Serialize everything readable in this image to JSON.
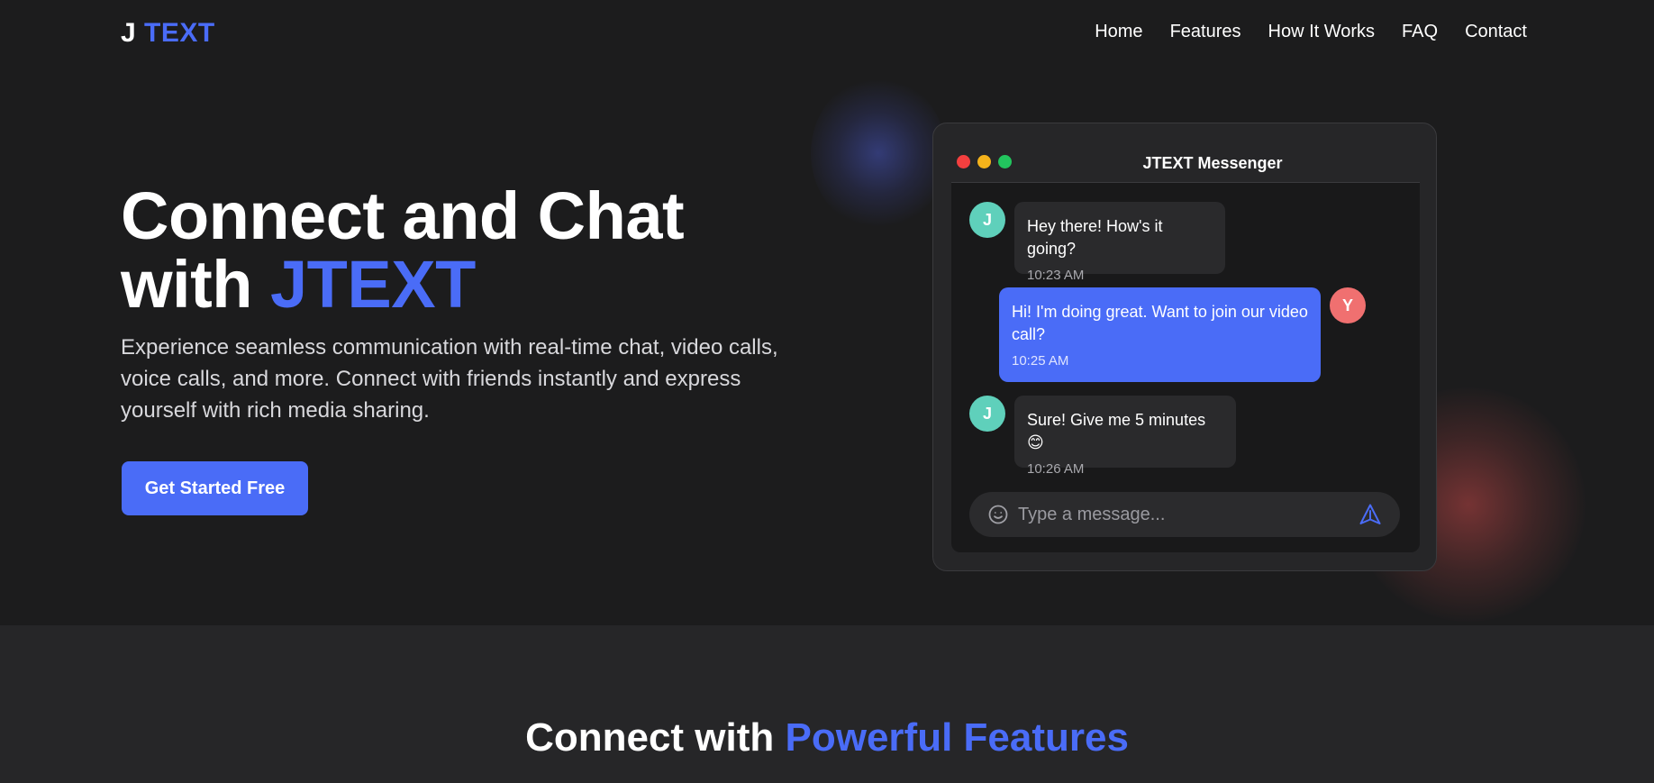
{
  "brand": {
    "logo_part1": "J",
    "logo_part2": "TEXT"
  },
  "nav": {
    "items": [
      {
        "label": "Home"
      },
      {
        "label": "Features"
      },
      {
        "label": "How It Works"
      },
      {
        "label": "FAQ"
      },
      {
        "label": "Contact"
      }
    ]
  },
  "hero": {
    "title_line1": "Connect and Chat",
    "title_with": "with ",
    "title_accent": "JTEXT",
    "subtitle": "Experience seamless communication with real-time chat, video calls, voice calls, and more. Connect with friends instantly and express yourself with rich media sharing.",
    "cta_label": "Get Started Free"
  },
  "chat": {
    "window_title": "JTEXT Messenger",
    "messages": [
      {
        "avatar": "J",
        "text": "Hey there! How's it going?",
        "time": "10:23 AM",
        "direction": "incoming"
      },
      {
        "avatar": "Y",
        "text": "Hi! I'm doing great. Want to join our video call?",
        "time": "10:25 AM",
        "direction": "outgoing"
      },
      {
        "avatar": "J",
        "text": "Sure! Give me 5 minutes 😊",
        "time": "10:26 AM",
        "direction": "incoming"
      }
    ],
    "input_placeholder": "Type a message...",
    "emoji_icon": "smiley-icon",
    "send_icon": "send-icon"
  },
  "features": {
    "title_plain": "Connect with ",
    "title_accent": "Powerful Features"
  },
  "colors": {
    "accent": "#4a6cf7",
    "background": "#1c1c1d",
    "avatar_j": "#5fd0bb",
    "avatar_y": "#f07070"
  }
}
